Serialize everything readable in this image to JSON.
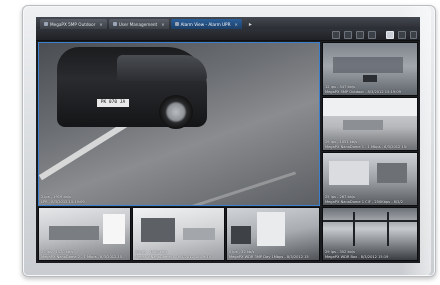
{
  "tabs": [
    {
      "label": "MegaPX 5MP Outdoor",
      "active": false
    },
    {
      "label": "User Management",
      "active": false
    },
    {
      "label": "Alarm View - Alarm UPR",
      "active": true
    }
  ],
  "main_view": {
    "plate_text": "PK 070 JA",
    "stats": "2 ips - 1919 kb/s",
    "camera": "LPR - 8/3/2012 15:19:09"
  },
  "side_views": [
    {
      "stats": "12 ips - 547 kb/s",
      "camera": "MegaPX 5MP Outdoor - 8/3/2012 15:19:09"
    },
    {
      "stats": "29 ips - 1051 kb/s",
      "camera": "MegaPX NanoDome 1 - 1 Mbps - 8/3/2012 15:"
    },
    {
      "stats": "25 ips - 267 kb/s",
      "camera": "MegaPX NanoDome 1 CIF - 250Kbps - 8/3/2"
    }
  ],
  "bottom_views": [
    {
      "stats": "29 ips - 1570 kb/s",
      "camera": "MegaPX NanoDome 2 - 1 Mbps - 8/3/2012 15"
    },
    {
      "stats": "29 ips - 1568 kb/s",
      "camera": "MegaPX NanoDome 3 - 8/3/2012 15:19:10"
    },
    {
      "stats": "0 ips - 32 kb/s",
      "camera": "MegaPX WDR 3MP Day 1Mbps - 8/3/2012 15"
    },
    {
      "stats": "29 ips - 352 kb/s",
      "camera": "MegaPX WDR Box - 8/3/2012 15:19"
    }
  ]
}
